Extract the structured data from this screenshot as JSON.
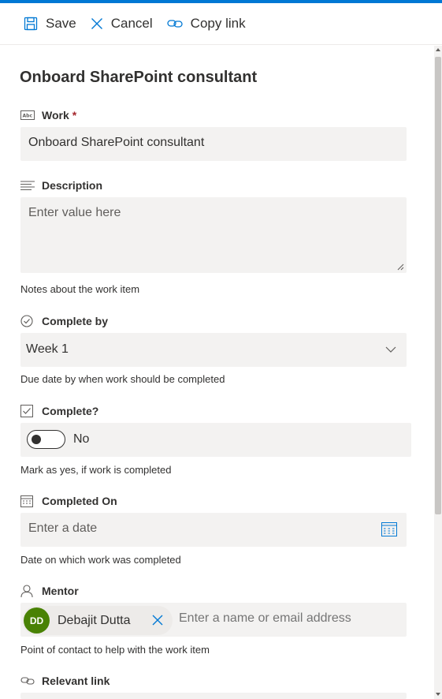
{
  "commands": {
    "save": "Save",
    "cancel": "Cancel",
    "copy_link": "Copy link"
  },
  "form": {
    "title": "Onboard SharePoint consultant",
    "work": {
      "label": "Work",
      "required_mark": "*",
      "value": "Onboard SharePoint consultant"
    },
    "description": {
      "label": "Description",
      "placeholder": "Enter value here",
      "help": "Notes about the work item"
    },
    "complete_by": {
      "label": "Complete by",
      "value": "Week 1",
      "help": "Due date by when work should be completed"
    },
    "complete": {
      "label": "Complete?",
      "state": "No",
      "help": "Mark as yes, if work is completed"
    },
    "completed_on": {
      "label": "Completed On",
      "placeholder": "Enter a date",
      "help": "Date on which work was completed"
    },
    "mentor": {
      "label": "Mentor",
      "person_initials": "DD",
      "person_name": "Debajit Dutta",
      "placeholder": "Enter a name or email address",
      "help": "Point of contact to help with the work item"
    },
    "relevant_link": {
      "label": "Relevant link"
    }
  },
  "colors": {
    "accent": "#0078d4",
    "field_bg": "#f3f2f1",
    "avatar_bg": "#498205",
    "required": "#a4262c"
  },
  "icons": {
    "save": "save-icon",
    "cancel": "close-icon",
    "copy_link": "link-icon",
    "work": "text-field-icon",
    "description": "multiline-text-icon",
    "complete_by": "choice-check-icon",
    "complete": "checkbox-icon",
    "completed_on": "calendar-icon",
    "mentor": "person-icon",
    "relevant_link": "link-icon"
  }
}
